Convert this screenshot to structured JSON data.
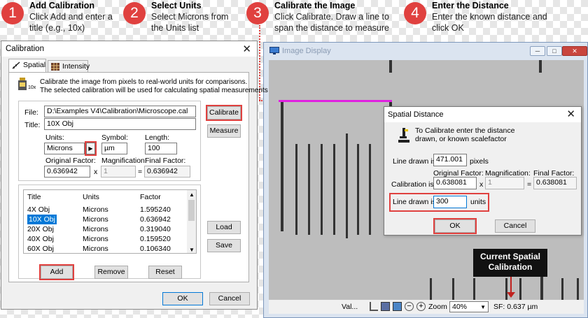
{
  "steps": [
    {
      "num": "1",
      "title": "Add Calibration",
      "desc": "Click Add and enter a title (e.g., 10x)"
    },
    {
      "num": "2",
      "title": "Select Units",
      "desc": "Select Microns from the Units list"
    },
    {
      "num": "3",
      "title": "Calibrate the Image",
      "desc": "Click Calibrate. Draw a line to span the distance to measure"
    },
    {
      "num": "4",
      "title": "Enter the Distance",
      "desc": "Enter the known distance and click OK"
    }
  ],
  "calibration_dialog": {
    "title": "Calibration",
    "tabs": [
      "Spatial",
      "Intensity"
    ],
    "info_line1": "Calibrate the image from pixels to real-world units for comparisons.",
    "info_line2": "The selected calibration will be used for calculating spatial measurements",
    "icon_caption": "10x",
    "file_label": "File:",
    "file_value": "D:\\Examples V4\\Calibration\\Microscope.cal",
    "title_label": "Title:",
    "title_value": "10X Obj",
    "units_label": "Units:",
    "units_value": "Microns",
    "symbol_label": "Symbol:",
    "symbol_value": "µm",
    "length_label": "Length:",
    "length_value": "100",
    "orig_factor_label": "Original Factor:",
    "orig_factor_value": "0.636942",
    "magnification_label": "Magnification:",
    "magnification_value": "1",
    "final_factor_label": "Final Factor:",
    "final_factor_value": "0.636942",
    "times": "x",
    "equals": "=",
    "buttons": {
      "calibrate": "Calibrate",
      "measure": "Measure",
      "load": "Load",
      "save": "Save",
      "add": "Add",
      "remove": "Remove",
      "reset": "Reset",
      "ok": "OK",
      "cancel": "Cancel"
    },
    "table": {
      "headers": [
        "Title",
        "Units",
        "Factor"
      ],
      "rows": [
        {
          "title": "4X Obj",
          "units": "Microns",
          "factor": "1.595240"
        },
        {
          "title": "10X Obj",
          "units": "Microns",
          "factor": "0.636942"
        },
        {
          "title": "20X Obj",
          "units": "Microns",
          "factor": "0.319040"
        },
        {
          "title": "40X Obj",
          "units": "Microns",
          "factor": "0.159520"
        },
        {
          "title": "60X Obj",
          "units": "Microns",
          "factor": "0.106340"
        }
      ],
      "selected_row": 1
    }
  },
  "image_window": {
    "title": "Image Display",
    "status_values": "Val...",
    "zoom_label": "Zoom",
    "zoom_value": "40%",
    "sf": "SF: 0.637 µm"
  },
  "spatial_distance": {
    "title": "Spatial Distance",
    "instruction_line1": "To Calibrate enter the distance",
    "instruction_line2": "drawn, or known scalefactor",
    "line_drawn_label": "Line drawn is:",
    "line_drawn_pixels": "471.001",
    "pixels_unit": "pixels",
    "orig_factor_label": "Original Factor:",
    "magnification_label": "Magnification:",
    "final_factor_label": "Final Factor:",
    "calibration_label": "Calibration is:",
    "orig_factor_value": "0.638081",
    "magnification_value": "1",
    "final_factor_value": "0.638081",
    "times": "x",
    "equals": "=",
    "line_drawn_units_value": "300",
    "units_unit": "units",
    "ok": "OK",
    "cancel": "Cancel"
  },
  "callout": {
    "line1": "Current Spatial",
    "line2": "Calibration"
  },
  "colors": {
    "accent": "#e0413f",
    "magenta_line": "#e020e0",
    "selection": "#0078d7"
  }
}
